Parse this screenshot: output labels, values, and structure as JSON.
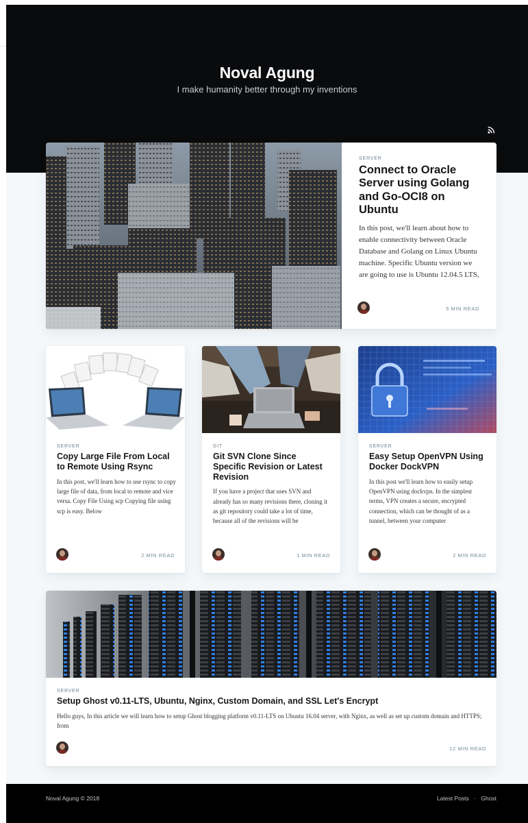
{
  "site": {
    "title": "Noval Agung",
    "description": "I make humanity better through my inventions"
  },
  "icons": {
    "rss": "rss-icon",
    "avatar": "author-avatar"
  },
  "colors": {
    "header_bg": "#0a0b0d",
    "page_bg": "#f4f8fb",
    "footer_bg": "#000000",
    "title_text": "#15171a",
    "meta_text": "#738a94"
  },
  "posts": [
    {
      "tag": "SERVER",
      "title": "Connect to Oracle Server using Golang and Go-OCI8 on Ubuntu",
      "excerpt": "In this post, we'll learn about how to enable connectivity between Oracle Database and Golang on Linux Ubuntu machine. Specific Ubuntu version we are going to use is Ubuntu 12.04.5 LTS,",
      "reading_time": "5 MIN READ",
      "image": "city-skyline-photo"
    },
    {
      "tag": "SERVER",
      "title": "Copy Large File From Local to Remote Using Rsync",
      "excerpt": "In this post, we'll learn how to use rsync to copy large file of data, from local to remote and vice versa. Copy File Using scp Copying file using scp is easy. Below",
      "reading_time": "2 MIN READ",
      "image": "laptops-file-transfer-photo"
    },
    {
      "tag": "GIT",
      "title": "Git SVN Clone Since Specific Revision or Latest Revision",
      "excerpt": "If you have a project that uses SVN and already has so many revisions there, cloning it as git repository could take a lot of time, because all of the revisions will be",
      "reading_time": "1 MIN READ",
      "image": "people-with-laptop-photo"
    },
    {
      "tag": "SERVER",
      "title": "Easy Setup OpenVPN Using Docker DockVPN",
      "excerpt": "In this post we'll learn how to easily setup OpenVPN using dockvpn. In the simplest terms, VPN creates a secure, encrypted connection, which can be thought of as a tunnel, between your computer",
      "reading_time": "2 MIN READ",
      "image": "digital-padlock-photo"
    },
    {
      "tag": "SERVER",
      "title": "Setup Ghost v0.11-LTS, Ubuntu, Nginx, Custom Domain, and SSL Let's Encrypt",
      "excerpt": "Hello guys, In this article we will learn how to setup Ghost blogging platform v0.11-LTS on Ubuntu 16.04 server, with Nginx, as well as set up custom domain and HTTPS; from",
      "reading_time": "12 MIN READ",
      "image": "server-racks-photo"
    }
  ],
  "footer": {
    "copyright": "Noval Agung © 2018",
    "links": [
      "Latest Posts",
      "Ghost"
    ],
    "separator": "·"
  }
}
